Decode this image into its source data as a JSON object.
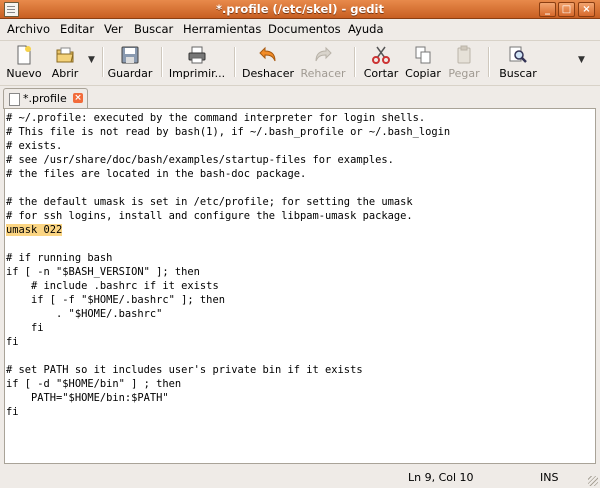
{
  "window": {
    "title": "*.profile (/etc/skel) - gedit",
    "controls": {
      "minimize": "_",
      "maximize": "□",
      "close": "×"
    }
  },
  "menu": [
    "Archivo",
    "Editar",
    "Ver",
    "Buscar",
    "Herramientas",
    "Documentos",
    "Ayuda"
  ],
  "toolbar": {
    "nuevo": "Nuevo",
    "abrir": "Abrir",
    "guardar": "Guardar",
    "imprimir": "Imprimir...",
    "deshacer": "Deshacer",
    "rehacer": "Rehacer",
    "cortar": "Cortar",
    "copiar": "Copiar",
    "pegar": "Pegar",
    "buscar": "Buscar",
    "disabled": [
      "rehacer",
      "pegar"
    ]
  },
  "tab": {
    "label": "*.profile",
    "close": "×"
  },
  "editor": {
    "lines": [
      "# ~/.profile: executed by the command interpreter for login shells.",
      "# This file is not read by bash(1), if ~/.bash_profile or ~/.bash_login",
      "# exists.",
      "# see /usr/share/doc/bash/examples/startup-files for examples.",
      "# the files are located in the bash-doc package.",
      "",
      "# the default umask is set in /etc/profile; for setting the umask",
      "# for ssh logins, install and configure the libpam-umask package.",
      "umask 022",
      "",
      "# if running bash",
      "if [ -n \"$BASH_VERSION\" ]; then",
      "    # include .bashrc if it exists",
      "    if [ -f \"$HOME/.bashrc\" ]; then",
      "        . \"$HOME/.bashrc\"",
      "    fi",
      "fi",
      "",
      "# set PATH so it includes user's private bin if it exists",
      "if [ -d \"$HOME/bin\" ] ; then",
      "    PATH=\"$HOME/bin:$PATH\"",
      "fi"
    ],
    "highlighted_line": 9,
    "highlight_color": "#fbd583"
  },
  "status": {
    "position": "Ln 9, Col 10",
    "mode": "INS"
  },
  "colors": {
    "titlebar": "#d86f31",
    "background": "#efebe7",
    "tab_close": "#f26b3a"
  }
}
